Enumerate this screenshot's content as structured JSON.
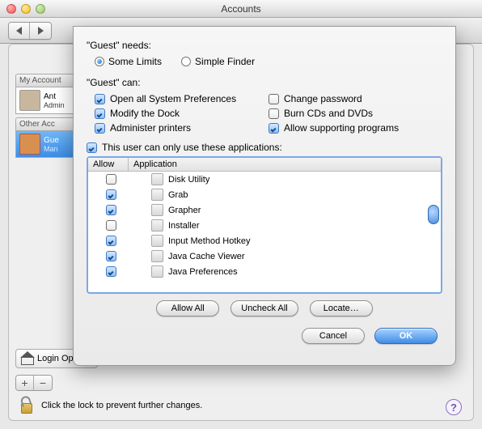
{
  "window": {
    "title": "Accounts"
  },
  "sidebar": {
    "sections": [
      {
        "header": "My Account",
        "accounts": [
          {
            "name": "Ant",
            "role": "Admin"
          }
        ]
      },
      {
        "header": "Other Acc",
        "accounts": [
          {
            "name": "Gue",
            "role": "Man"
          }
        ]
      }
    ],
    "login_options": "Login Options"
  },
  "footer": {
    "lock_text": "Click the lock to prevent further changes."
  },
  "sheet": {
    "needs_label": "\"Guest\" needs:",
    "radios": [
      {
        "label": "Some Limits",
        "on": true
      },
      {
        "label": "Simple Finder",
        "on": false
      }
    ],
    "can_label": "\"Guest\" can:",
    "caps": [
      {
        "label": "Open all System Preferences",
        "on": true
      },
      {
        "label": "Change password",
        "on": false
      },
      {
        "label": "Modify the Dock",
        "on": true
      },
      {
        "label": "Burn CDs and DVDs",
        "on": false
      },
      {
        "label": "Administer printers",
        "on": true
      },
      {
        "label": "Allow supporting programs",
        "on": true
      }
    ],
    "limit_apps": {
      "label": "This user can only use these applications:",
      "on": true
    },
    "table": {
      "col_allow": "Allow",
      "col_app": "Application",
      "rows": [
        {
          "allow": false,
          "name": "Disk Utility"
        },
        {
          "allow": true,
          "name": "Grab"
        },
        {
          "allow": true,
          "name": "Grapher"
        },
        {
          "allow": false,
          "name": "Installer"
        },
        {
          "allow": true,
          "name": "Input Method Hotkey"
        },
        {
          "allow": true,
          "name": "Java Cache Viewer"
        },
        {
          "allow": true,
          "name": "Java Preferences"
        }
      ]
    },
    "buttons": {
      "allow_all": "Allow All",
      "uncheck_all": "Uncheck All",
      "locate": "Locate…",
      "cancel": "Cancel",
      "ok": "OK"
    }
  }
}
